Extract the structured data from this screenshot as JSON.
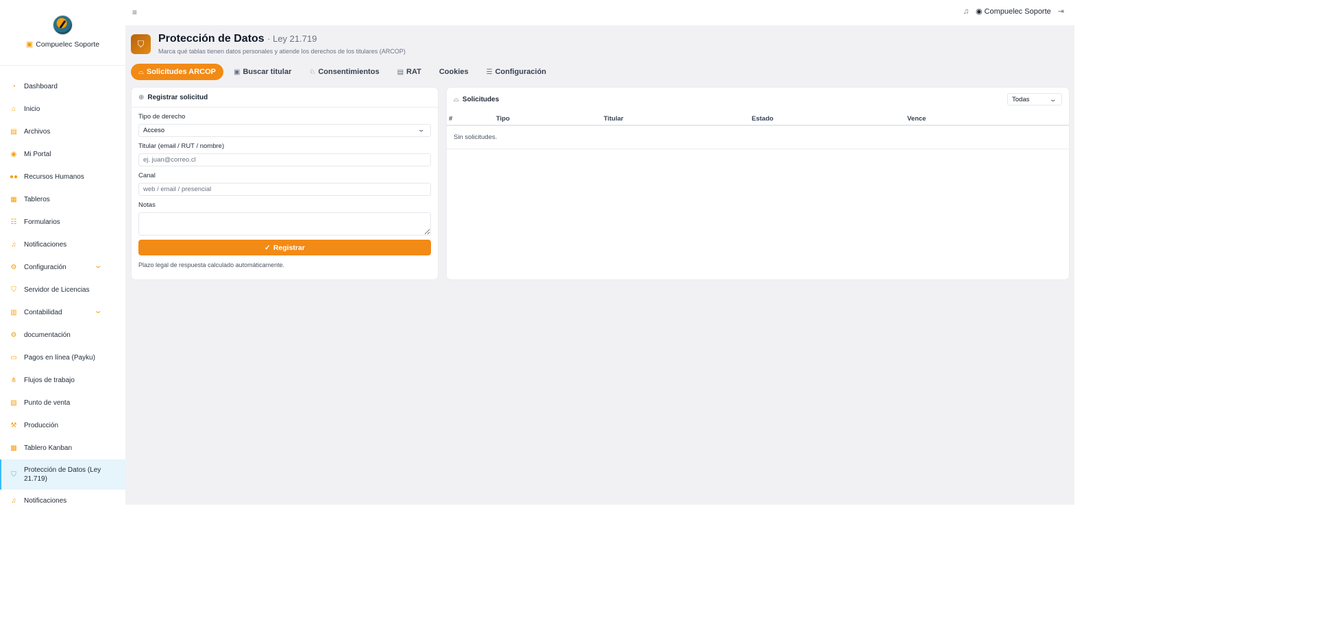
{
  "brand": {
    "name": "Compuelec Soporte"
  },
  "sidebar": {
    "items": [
      {
        "label": "Dashboard",
        "icon": "dashboard-icon"
      },
      {
        "label": "Inicio",
        "icon": "home-icon"
      },
      {
        "label": "Archivos",
        "icon": "file-icon"
      },
      {
        "label": "Mi Portal",
        "icon": "user-circle-icon"
      },
      {
        "label": "Recursos Humanos",
        "icon": "users-icon"
      },
      {
        "label": "Tableros",
        "icon": "grid-icon"
      },
      {
        "label": "Formularios",
        "icon": "form-icon"
      },
      {
        "label": "Notificaciones",
        "icon": "bell-icon"
      },
      {
        "label": "Configuración",
        "icon": "gear-icon",
        "expandable": true
      },
      {
        "label": "Servidor de Licencias",
        "icon": "shield-icon"
      },
      {
        "label": "Contabilidad",
        "icon": "calculator-icon",
        "expandable": true
      },
      {
        "label": "documentación",
        "icon": "gear-icon"
      },
      {
        "label": "Pagos en línea (Payku)",
        "icon": "credit-card-icon"
      },
      {
        "label": "Flujos de trabajo",
        "icon": "workflow-icon"
      },
      {
        "label": "Punto de venta",
        "icon": "receipt-icon"
      },
      {
        "label": "Producción",
        "icon": "hammer-icon"
      },
      {
        "label": "Tablero Kanban",
        "icon": "kanban-icon"
      },
      {
        "label": "Protección de Datos (Ley 21.719)",
        "icon": "shield-icon",
        "active": true
      },
      {
        "label": "Notificaciones",
        "icon": "bell-icon"
      }
    ]
  },
  "topbar": {
    "user": "Compuelec Soporte"
  },
  "page": {
    "title": "Protección de Datos",
    "subtitle": "· Ley 21.719",
    "description": "Marca qué tablas tienen datos personales y atiende los derechos de los titulares (ARCOP)"
  },
  "tabs": [
    {
      "label": "Solicitudes ARCOP",
      "active": true
    },
    {
      "label": "Buscar titular"
    },
    {
      "label": "Consentimientos"
    },
    {
      "label": "RAT"
    },
    {
      "label": "Cookies"
    },
    {
      "label": "Configuración"
    }
  ],
  "form": {
    "title": "Registrar solicitud",
    "tipo_label": "Tipo de derecho",
    "tipo_value": "Acceso",
    "titular_label": "Titular (email / RUT / nombre)",
    "titular_placeholder": "ej. juan@correo.cl",
    "canal_label": "Canal",
    "canal_placeholder": "web / email / presencial",
    "notas_label": "Notas",
    "submit_label": "Registrar",
    "help": "Plazo legal de respuesta calculado automáticamente."
  },
  "solicitudes": {
    "title": "Solicitudes",
    "filter_value": "Todas",
    "columns": [
      "#",
      "Tipo",
      "Titular",
      "Estado",
      "Vence"
    ],
    "empty": "Sin solicitudes."
  },
  "colors": {
    "accent": "#f28a16",
    "active_nav": "#e6f4fb"
  }
}
